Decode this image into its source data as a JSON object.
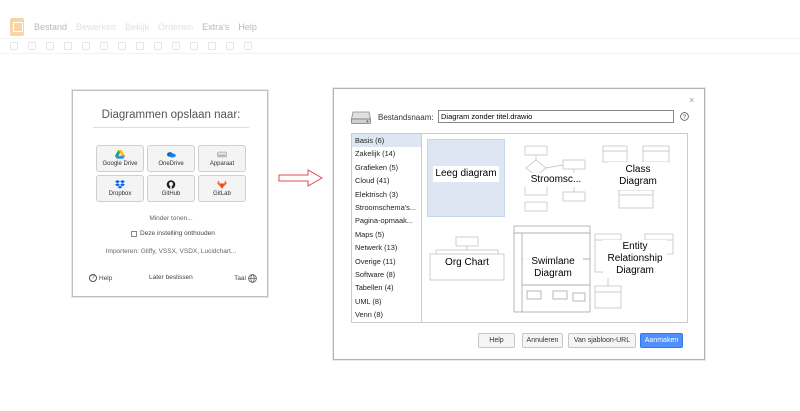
{
  "menu": {
    "items": [
      "Bestand",
      "Bewerken",
      "Bekijk",
      "Ordenen",
      "Extra's",
      "Help"
    ]
  },
  "save_dialog": {
    "title": "Diagrammen opslaan naar:",
    "providers": [
      {
        "label": "Google Drive",
        "icon": "google-drive-icon"
      },
      {
        "label": "OneDrive",
        "icon": "onedrive-icon"
      },
      {
        "label": "Apparaat",
        "icon": "device-icon"
      },
      {
        "label": "Dropbox",
        "icon": "dropbox-icon"
      },
      {
        "label": "GitHub",
        "icon": "github-icon"
      },
      {
        "label": "GitLab",
        "icon": "gitlab-icon"
      }
    ],
    "show_less": "Minder tonen...",
    "remember": "Deze instelling onthouden",
    "import": "Importeren: Gliffy, VSSX, VSDX, Lucidchart...",
    "footer": {
      "help": "Help",
      "later": "Later beslissen",
      "language": "Taal"
    }
  },
  "new_dialog": {
    "filename_label": "Bestandsnaam:",
    "filename_value": "Diagram zonder titel.drawio",
    "categories": [
      "Basis (6)",
      "Zakelijk (14)",
      "Grafieken (5)",
      "Cloud (41)",
      "Elektrisch (3)",
      "Stroomschema's...",
      "Pagina-opmaak...",
      "Maps (5)",
      "Netwerk (13)",
      "Overige (11)",
      "Software (8)",
      "Tabellen (4)",
      "UML (8)",
      "Venn (8)"
    ],
    "selected_category": "Basis (6)",
    "templates": {
      "blank": "Leeg diagram",
      "flowchart": "Stroomsc...",
      "class": "Class Diagram",
      "org": "Org Chart",
      "swimlane": "Swimlane Diagram",
      "er": "Entity Relationship Diagram"
    },
    "buttons": {
      "help": "Help",
      "cancel": "Annuleren",
      "from_url": "Van sjabloon-URL",
      "create": "Aanmaken"
    }
  },
  "colors": {
    "accent": "#4d90fe",
    "selection": "#dde6f2",
    "arrow": "#e24a4a",
    "logo": "#f08705"
  }
}
